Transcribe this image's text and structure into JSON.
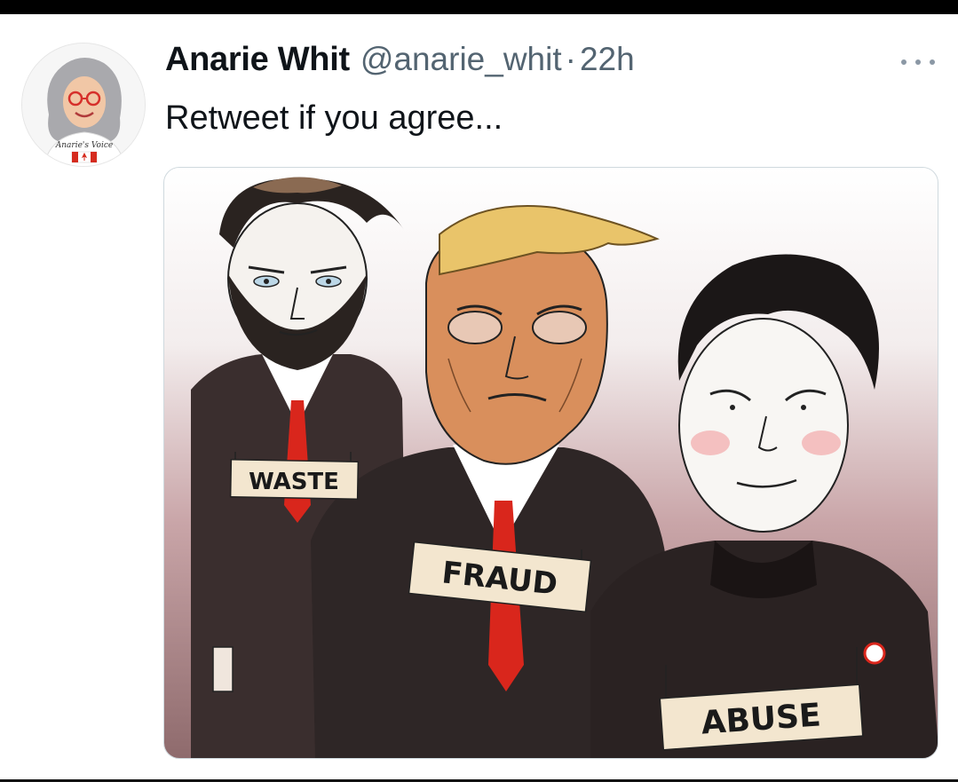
{
  "tweet": {
    "display_name": "Anarie Whit",
    "handle": "@anarie_whit",
    "separator": "·",
    "time": "22h",
    "text": "Retweet if you agree...",
    "more_icon": "more-horizontal-icon"
  },
  "avatar": {
    "shirt_text": "Anarie's Voice"
  },
  "image": {
    "labels": [
      "WASTE",
      "FRAUD",
      "ABUSE"
    ]
  },
  "colors": {
    "name": "#0f1419",
    "secondary": "#536471",
    "tie_red": "#d9261c"
  }
}
